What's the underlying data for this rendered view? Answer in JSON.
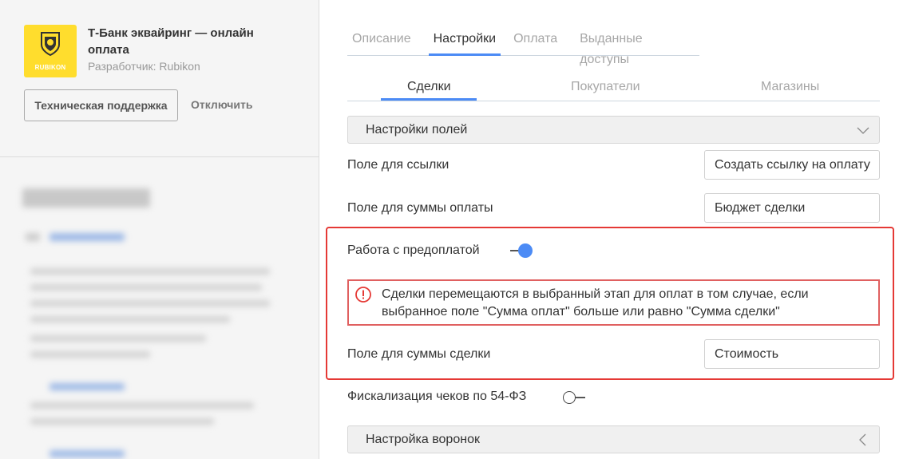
{
  "app": {
    "logo_text": "RUBIKON",
    "title": "Т-Банк эквайринг — онлайн оплата",
    "developer": "Разработчик: Rubikon",
    "support_button": "Техническая поддержка",
    "disable_button": "Отключить"
  },
  "tabs": [
    {
      "label": "Описание",
      "active": false
    },
    {
      "label": "Настройки",
      "active": true
    },
    {
      "label": "Оплата",
      "active": false
    },
    {
      "label": "Выданные доступы",
      "active": false
    }
  ],
  "subtabs": [
    {
      "label": "Сделки",
      "active": true
    },
    {
      "label": "Покупатели",
      "active": false
    },
    {
      "label": "Магазины",
      "active": false
    }
  ],
  "settings": {
    "fields_section": "Настройки полей",
    "link_field_label": "Поле для ссылки",
    "link_field_value": "Создать ссылку на оплату",
    "payment_sum_label": "Поле для суммы оплаты",
    "payment_sum_value": "Бюджет сделки",
    "prepayment_label": "Работа с предоплатой",
    "prepayment_enabled": true,
    "alert_text": "Сделки перемещаются в выбранный этап для оплат в том случае, если выбранное поле \"Сумма оплат\" больше или равно \"Сумма сделки\"",
    "deal_sum_label": "Поле для суммы сделки",
    "deal_sum_value": "Стоимость",
    "fiscal_label": "Фискализация чеков по 54-ФЗ",
    "fiscal_enabled": false,
    "funnels_section": "Настройка воронок"
  },
  "colors": {
    "accent": "#4c8bf5",
    "alert_red": "#e53935",
    "logo_yellow": "#ffdd2d"
  }
}
